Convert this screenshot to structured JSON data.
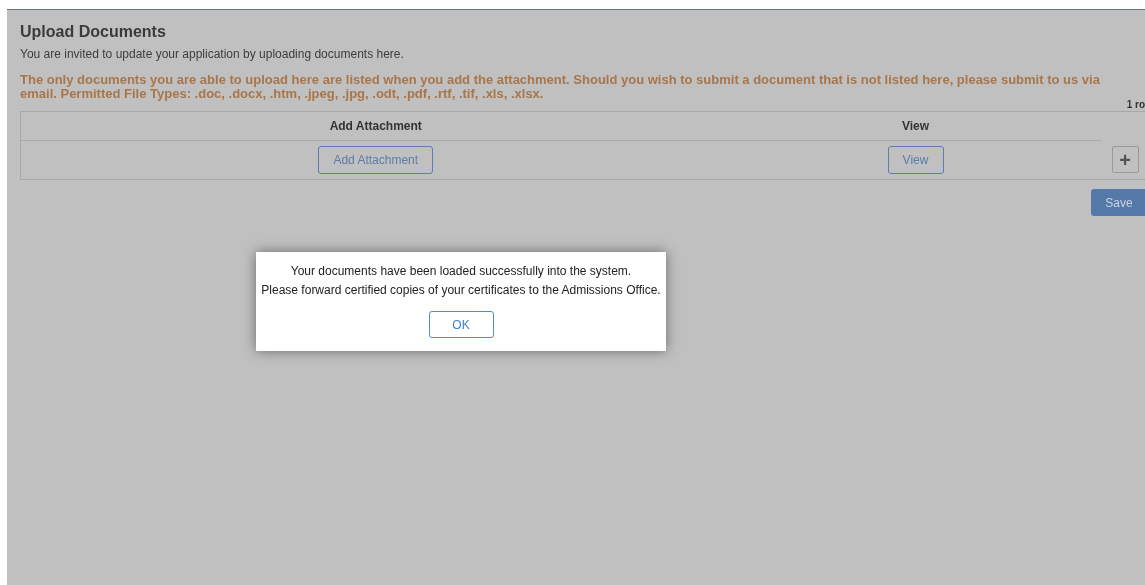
{
  "page": {
    "title": "Upload Documents",
    "intro": "You are invited to update your application by uploading documents here.",
    "notice": "The only documents you are able to upload here are listed when you add the attachment.  Should you wish to submit a document that is not listed here, please submit to us via email. Permitted File Types: .doc, .docx, .htm, .jpeg, .jpg, .odt, .pdf, .rtf, .tif, .xls, .xlsx."
  },
  "table": {
    "row_count": "1 ro",
    "columns": [
      "Add Attachment",
      "View"
    ],
    "rows": [
      {
        "add_button": "Add Attachment",
        "view_button": "View",
        "add_row_button": "+"
      }
    ]
  },
  "save_button": "Save",
  "dialog": {
    "lines": [
      "Your documents have been loaded successfully into the system.",
      "Please forward certified copies of your certificates to the Admissions Office."
    ],
    "button": "OK"
  }
}
